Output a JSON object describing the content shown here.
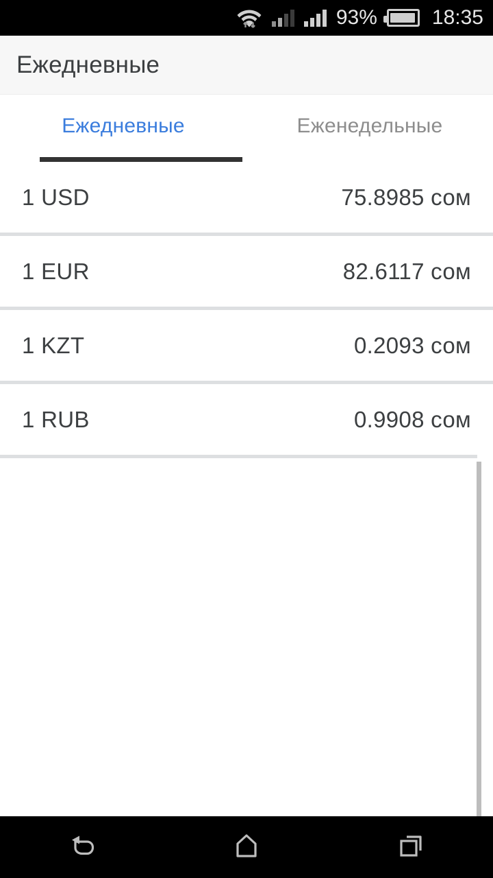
{
  "status_bar": {
    "wifi_icon": "wifi-with-transfer-arrows-icon",
    "signal_1_icon": "cellular-signal-bars-icon",
    "signal_2_icon": "cellular-signal-bars-icon",
    "battery_percent": "93%",
    "battery_icon": "battery-icon",
    "time": "18:35",
    "background": "#000000",
    "foreground": "#e6e6e6"
  },
  "header": {
    "title": "Ежедневные",
    "background": "#f7f7f7",
    "text_color": "#3c3f41"
  },
  "tabs": {
    "items": [
      {
        "label": "Ежедневные",
        "active": true
      },
      {
        "label": "Еженедельные",
        "active": false
      }
    ],
    "active_color": "#3b7ddd",
    "inactive_color": "#8d8d8d",
    "indicator_color": "#333333"
  },
  "rates": {
    "currency_unit": "сом",
    "rows": [
      {
        "code": "1 USD",
        "value": "75.8985 сом"
      },
      {
        "code": "1 EUR",
        "value": "82.6117 сом"
      },
      {
        "code": "1 KZT",
        "value": "0.2093 сом"
      },
      {
        "code": "1 RUB",
        "value": "0.9908 сом"
      }
    ],
    "divider_color": "#dddfe1",
    "text_color": "#3c3f41"
  },
  "scrollbar": {
    "color": "#bdbdbd"
  },
  "nav_bar": {
    "background": "#000000",
    "items": [
      {
        "icon": "back-icon",
        "label": "Назад"
      },
      {
        "icon": "home-icon",
        "label": "Домой"
      },
      {
        "icon": "recents-icon",
        "label": "Недавние"
      }
    ]
  },
  "chart_data": null
}
